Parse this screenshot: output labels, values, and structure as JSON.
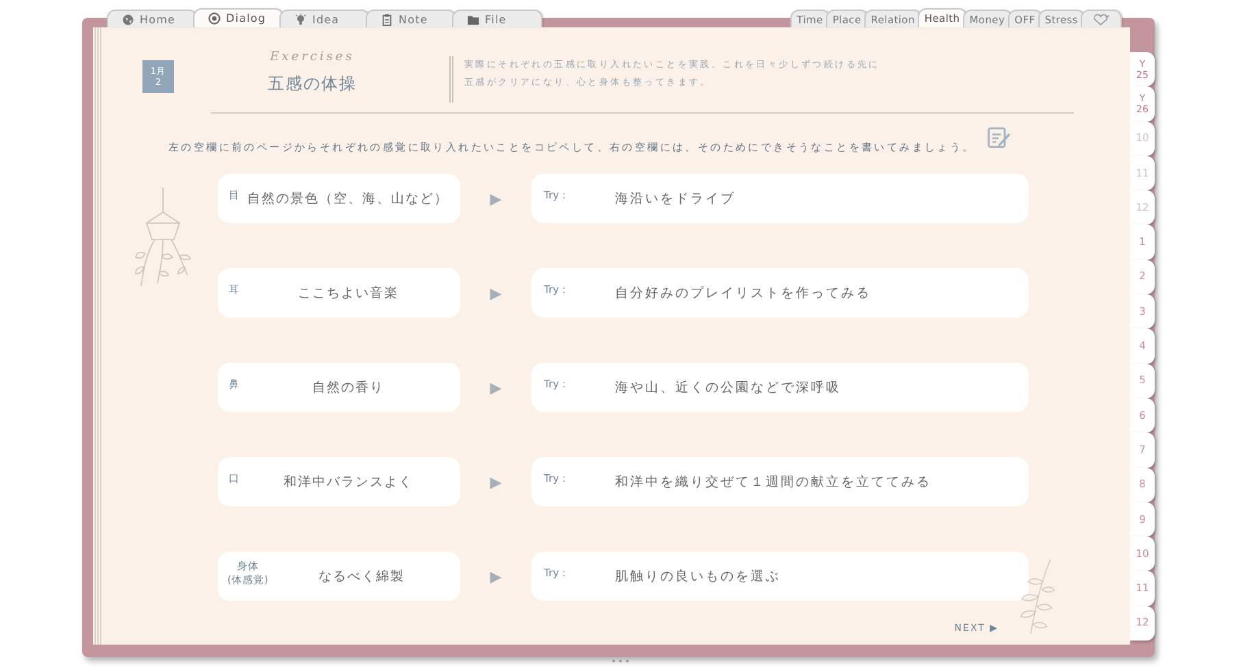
{
  "left_tabs": [
    {
      "label": "Home",
      "selected": false
    },
    {
      "label": "Dialog",
      "selected": true
    },
    {
      "label": "Idea",
      "selected": false
    },
    {
      "label": "Note",
      "selected": false
    },
    {
      "label": "File",
      "selected": false
    }
  ],
  "right_tabs": [
    {
      "label": "Time",
      "selected": false
    },
    {
      "label": "Place",
      "selected": false
    },
    {
      "label": "Relation",
      "selected": false
    },
    {
      "label": "Health",
      "selected": true
    },
    {
      "label": "Money",
      "selected": false
    },
    {
      "label": "OFF",
      "selected": false
    },
    {
      "label": "Stress",
      "selected": false
    }
  ],
  "side_tabs": [
    {
      "kind": "year",
      "lines": [
        "Y",
        "25"
      ],
      "muted": false
    },
    {
      "kind": "year",
      "lines": [
        "Y",
        "26"
      ],
      "muted": false
    },
    {
      "kind": "month",
      "lines": [
        "10"
      ],
      "muted": true
    },
    {
      "kind": "month",
      "lines": [
        "11"
      ],
      "muted": true
    },
    {
      "kind": "month",
      "lines": [
        "12"
      ],
      "muted": true
    },
    {
      "kind": "month",
      "lines": [
        "1"
      ],
      "muted": false
    },
    {
      "kind": "month",
      "lines": [
        "2"
      ],
      "muted": false
    },
    {
      "kind": "month",
      "lines": [
        "3"
      ],
      "muted": false
    },
    {
      "kind": "month",
      "lines": [
        "4"
      ],
      "muted": false
    },
    {
      "kind": "month",
      "lines": [
        "5"
      ],
      "muted": false
    },
    {
      "kind": "month",
      "lines": [
        "6"
      ],
      "muted": false
    },
    {
      "kind": "month",
      "lines": [
        "7"
      ],
      "muted": false
    },
    {
      "kind": "month",
      "lines": [
        "8"
      ],
      "muted": false
    },
    {
      "kind": "month",
      "lines": [
        "9"
      ],
      "muted": false
    },
    {
      "kind": "month",
      "lines": [
        "10"
      ],
      "muted": false
    },
    {
      "kind": "month",
      "lines": [
        "11"
      ],
      "muted": false
    },
    {
      "kind": "month",
      "lines": [
        "12"
      ],
      "muted": false
    }
  ],
  "date_badge": [
    "1月",
    "2"
  ],
  "header": {
    "script_title": "Exercises",
    "title": "五感の体操",
    "description": [
      "実際にそれぞれの五感に取り入れたいことを実践。これを日々少しずつ続ける先に",
      "五感がクリアになり、心と身体も整ってきます。"
    ]
  },
  "instruction": "左の空欄に前のページからそれぞれの感覚に取り入れたいことをコピペして、右の空欄には、そのためにできそうなことを書いてみましょう。",
  "rows": [
    {
      "sense": [
        "目"
      ],
      "item": "自然の景色（空、海、山など）",
      "arrow": "▶",
      "try_label": "Try：",
      "action": "海沿いをドライブ"
    },
    {
      "sense": [
        "耳"
      ],
      "item": "ここちよい音楽",
      "arrow": "▶",
      "try_label": "Try：",
      "action": "自分好みのプレイリストを作ってみる"
    },
    {
      "sense": [
        "鼻"
      ],
      "item": "自然の香り",
      "arrow": "▶",
      "try_label": "Try：",
      "action": "海や山、近くの公園などで深呼吸"
    },
    {
      "sense": [
        "口"
      ],
      "item": "和洋中バランスよく",
      "arrow": "▶",
      "try_label": "Try：",
      "action": "和洋中を織り交ぜて１週間の献立を立ててみる"
    },
    {
      "sense": [
        "身体",
        "(体感覚)"
      ],
      "item": "なるべく綿製",
      "arrow": "▶",
      "try_label": "Try：",
      "action": "肌触りの良いものを選ぶ"
    }
  ],
  "next": "NEXT ▶"
}
